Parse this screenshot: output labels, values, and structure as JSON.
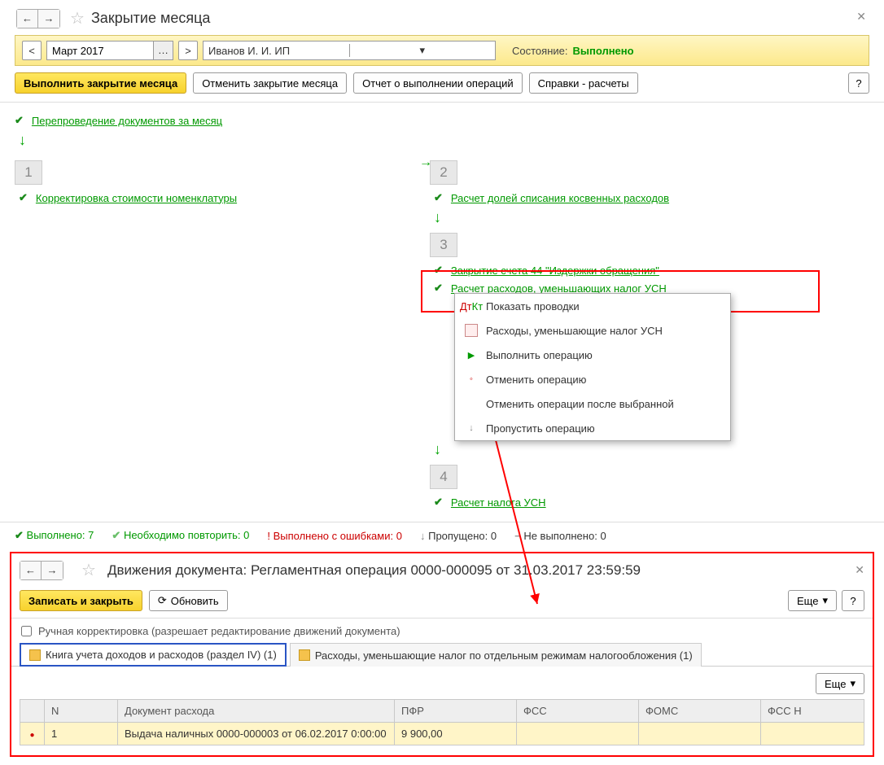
{
  "header": {
    "title": "Закрытие месяца"
  },
  "filter": {
    "period_value": "Март 2017",
    "org_value": "Иванов И. И. ИП",
    "status_label": "Состояние:",
    "status_value": "Выполнено"
  },
  "toolbar": {
    "run_label": "Выполнить закрытие месяца",
    "cancel_label": "Отменить закрытие месяца",
    "report_label": "Отчет о выполнении операций",
    "ref_label": "Справки - расчеты",
    "help": "?"
  },
  "process": {
    "repost": "Перепроведение документов за месяц",
    "steps": {
      "s1": {
        "num": "1",
        "item1": "Корректировка стоимости номенклатуры"
      },
      "s2": {
        "num": "2",
        "item1": "Расчет долей списания косвенных расходов"
      },
      "s3": {
        "num": "3",
        "item1": "Закрытие счета 44 \"Издержки обращения\"",
        "item2": "Расчет расходов, уменьшающих налог УСН"
      },
      "s4": {
        "num": "4",
        "item1": "Расчет налога УСН"
      }
    }
  },
  "menu": {
    "m1": "Показать проводки",
    "m2": "Расходы, уменьшающие налог УСН",
    "m3": "Выполнить операцию",
    "m4": "Отменить операцию",
    "m5": "Отменить операции после выбранной",
    "m6": "Пропустить операцию"
  },
  "summary": {
    "done_label": "Выполнено:",
    "done_count": "7",
    "repeat_label": "Необходимо повторить:",
    "repeat_count": "0",
    "errors_label": "Выполнено с ошибками:",
    "errors_count": "0",
    "skipped_label": "Пропущено:",
    "skipped_count": "0",
    "pending_label": "Не выполнено:",
    "pending_count": "0"
  },
  "section2": {
    "title": "Движения документа: Регламентная операция 0000-000095 от 31.03.2017 23:59:59",
    "save_close": "Записать и закрыть",
    "refresh": "Обновить",
    "more": "Еще",
    "help": "?",
    "manual_label": "Ручная корректировка (разрешает редактирование движений документа)",
    "tabs": {
      "t1": "Книга учета доходов и расходов (раздел IV) (1)",
      "t2": "Расходы, уменьшающие налог по отдельным режимам налогообложения (1)"
    },
    "table_more": "Еще",
    "table": {
      "h_n": "N",
      "h_doc": "Документ расхода",
      "h_pfr": "ПФР",
      "h_fss": "ФСС",
      "h_foms": "ФОМС",
      "h_fssn": "ФСС Н",
      "row1": {
        "n": "1",
        "doc": "Выдача наличных 0000-000003 от 06.02.2017 0:00:00",
        "pfr": "9 900,00",
        "fss": "",
        "foms": "",
        "fssn": ""
      }
    }
  }
}
